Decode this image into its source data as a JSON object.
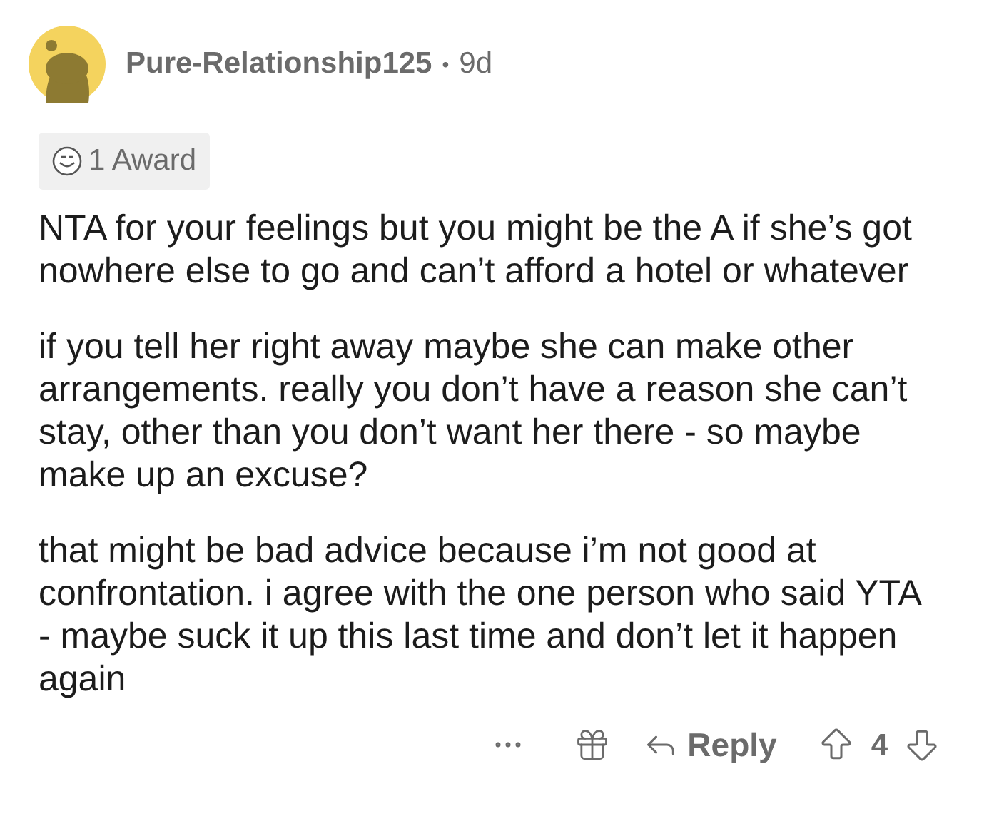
{
  "comment": {
    "author": "Pure-Relationship125",
    "separator": "•",
    "age": "9d",
    "award": "1 Award",
    "paragraphs": [
      "NTA for your feelings but you might be the A if she’s got nowhere else to go and can’t afford a hotel or whatever",
      "if you tell her right away maybe she can make other arrangements. really you don’t have a reason she can’t stay, other than you don’t want her there - so maybe make up an excuse?",
      "that might be bad advice because i’m not good at confrontation. i agree with the one person who said YTA - maybe suck it up this last time and don’t let it happen again"
    ],
    "reply": "Reply",
    "score": "4"
  }
}
